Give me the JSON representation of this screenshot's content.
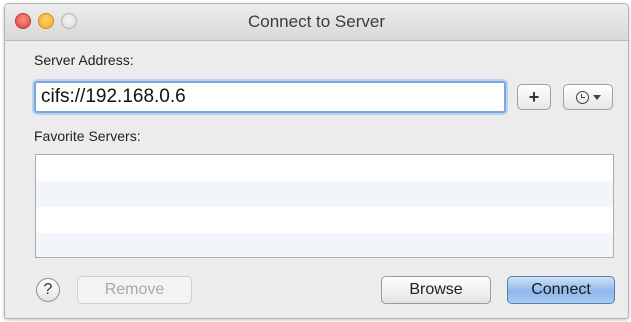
{
  "window": {
    "title": "Connect to Server"
  },
  "server_address": {
    "label": "Server Address:",
    "value": "cifs://192.168.0.6",
    "add_label": "+"
  },
  "favorites": {
    "label": "Favorite Servers:",
    "items": []
  },
  "footer": {
    "help_label": "?",
    "remove_label": "Remove",
    "browse_label": "Browse",
    "connect_label": "Connect"
  },
  "icons": {
    "close": "close-icon",
    "minimize": "minimize-icon",
    "zoom": "zoom-icon",
    "recent_servers": "clock-icon",
    "dropdown": "chevron-down-icon"
  },
  "colors": {
    "close": "#e0443b",
    "minimize": "#f4a624",
    "zoom": "#d9d9d9",
    "focus_ring": "#7ba7df",
    "default_button": "#8fb8ea"
  }
}
